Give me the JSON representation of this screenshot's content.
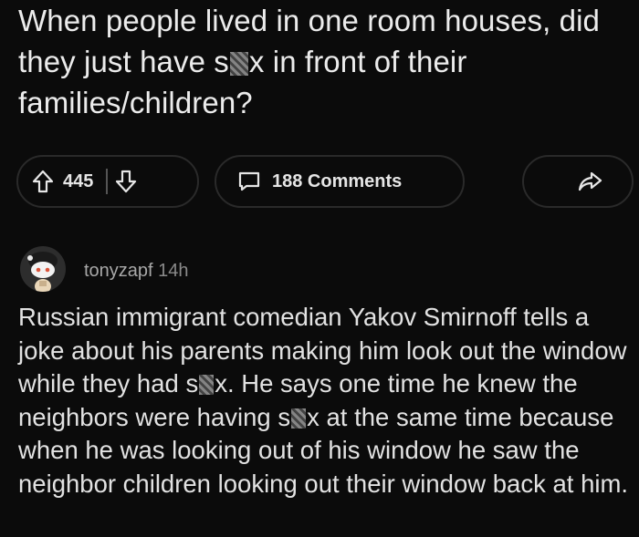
{
  "post": {
    "title_before": "When people lived in one room houses, did they just have s",
    "title_after": "x in front of their families/children?"
  },
  "actions": {
    "score": "445",
    "comments_label": "188 Comments"
  },
  "icons": {
    "upvote": "arrow-up-icon",
    "downvote": "arrow-down-icon",
    "comments": "speech-bubble-icon",
    "share": "share-arrow-icon",
    "avatar": "snoo-avatar-icon",
    "censor": "pixelated-censor-block"
  },
  "comment": {
    "author": "tonyzapf",
    "age": "14h",
    "body_part1": "Russian immigrant comedian Yakov Smirnoff tells a joke about his parents making him look out the window while they had s",
    "body_part2": "x. He says one time he knew the neighbors were having s",
    "body_part3": "x at the same time because when he was looking out of his window he saw the neighbor children looking out their window back at him."
  },
  "colors": {
    "background": "#0b0b0b",
    "text": "#e6e6e6",
    "muted": "#a8a8a8",
    "pill_border": "#2a2a2a"
  }
}
